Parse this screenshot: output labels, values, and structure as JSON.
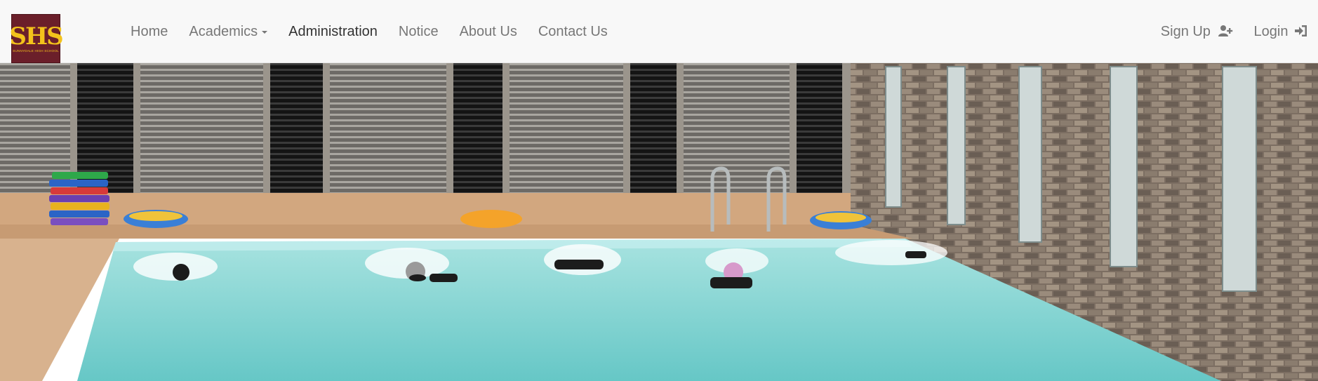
{
  "brand": {
    "logo_text": "SHS",
    "logo_subtext": "SUNNYDALE HIGH SCHOOL",
    "color_bg": "#6b1f2a",
    "color_fg": "#f3c21b"
  },
  "nav": {
    "items": [
      {
        "label": "Home"
      },
      {
        "label": "Academics",
        "dropdown": true
      },
      {
        "label": "Administration",
        "active": true
      },
      {
        "label": "Notice"
      },
      {
        "label": "About Us"
      },
      {
        "label": "Contact Us"
      }
    ],
    "right": [
      {
        "label": "Sign Up",
        "icon": "user-plus-icon"
      },
      {
        "label": "Login",
        "icon": "sign-in-icon"
      }
    ],
    "colors": {
      "text": "#777777",
      "active": "#333333",
      "bg": "#f8f8f8"
    }
  },
  "hero": {
    "icon": "swimming-pool-photo",
    "colors": {
      "water": "#7fd3d2",
      "wall": "#8a7a6a",
      "shutter": "#2b2b2b"
    }
  }
}
